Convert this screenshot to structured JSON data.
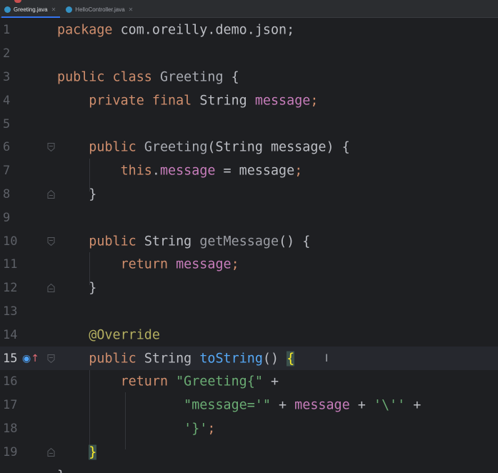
{
  "tabs": [
    {
      "label": "Greeting.java",
      "active": true
    },
    {
      "label": "HelloController.java",
      "active": false
    }
  ],
  "editor": {
    "current_line": 15,
    "lines": [
      {
        "num": "1",
        "tokens": [
          [
            "kw",
            "package"
          ],
          [
            "cls",
            " com.oreilly.demo.json;"
          ]
        ]
      },
      {
        "num": "2",
        "tokens": []
      },
      {
        "num": "3",
        "tokens": [
          [
            "kw",
            "public class "
          ],
          [
            "gray",
            "Greeting"
          ],
          [
            "cls",
            " {"
          ]
        ]
      },
      {
        "num": "4",
        "tokens": [
          [
            "cls",
            "    "
          ],
          [
            "kw",
            "private final "
          ],
          [
            "cls",
            "String "
          ],
          [
            "fld",
            "message"
          ],
          [
            "kw",
            ";"
          ]
        ]
      },
      {
        "num": "5",
        "tokens": []
      },
      {
        "num": "6",
        "tokens": [
          [
            "cls",
            "    "
          ],
          [
            "kw",
            "public "
          ],
          [
            "gray",
            "Greeting"
          ],
          [
            "cls",
            "(String message) {"
          ]
        ]
      },
      {
        "num": "7",
        "tokens": [
          [
            "cls",
            "        "
          ],
          [
            "kw",
            "this"
          ],
          [
            "cls",
            "."
          ],
          [
            "fld",
            "message"
          ],
          [
            "cls",
            " = message"
          ],
          [
            "kw",
            ";"
          ]
        ]
      },
      {
        "num": "8",
        "tokens": [
          [
            "cls",
            "    }"
          ]
        ]
      },
      {
        "num": "9",
        "tokens": []
      },
      {
        "num": "10",
        "tokens": [
          [
            "cls",
            "    "
          ],
          [
            "kw",
            "public "
          ],
          [
            "cls",
            "String "
          ],
          [
            "meth",
            "getMessage"
          ],
          [
            "cls",
            "() {"
          ]
        ]
      },
      {
        "num": "11",
        "tokens": [
          [
            "cls",
            "        "
          ],
          [
            "kw",
            "return "
          ],
          [
            "fld",
            "message"
          ],
          [
            "kw",
            ";"
          ]
        ]
      },
      {
        "num": "12",
        "tokens": [
          [
            "cls",
            "    }"
          ]
        ]
      },
      {
        "num": "13",
        "tokens": []
      },
      {
        "num": "14",
        "tokens": [
          [
            "cls",
            "    "
          ],
          [
            "ann",
            "@Override"
          ]
        ]
      },
      {
        "num": "15",
        "tokens": [
          [
            "cls",
            "    "
          ],
          [
            "kw",
            "public "
          ],
          [
            "cls",
            "String "
          ],
          [
            "fn",
            "toString"
          ],
          [
            "cls",
            "() "
          ],
          [
            "brace-hl",
            "{"
          ]
        ]
      },
      {
        "num": "16",
        "tokens": [
          [
            "cls",
            "        "
          ],
          [
            "kw",
            "return "
          ],
          [
            "str",
            "\"Greeting{\""
          ],
          [
            "cls",
            " +"
          ]
        ]
      },
      {
        "num": "17",
        "tokens": [
          [
            "cls",
            "                "
          ],
          [
            "str",
            "\"message='\""
          ],
          [
            "cls",
            " + "
          ],
          [
            "fld",
            "message"
          ],
          [
            "cls",
            " + "
          ],
          [
            "str",
            "'\\''"
          ],
          [
            "cls",
            " +"
          ]
        ]
      },
      {
        "num": "18",
        "tokens": [
          [
            "cls",
            "                "
          ],
          [
            "str",
            "'}'"
          ],
          [
            "kw",
            ";"
          ]
        ]
      },
      {
        "num": "19",
        "tokens": [
          [
            "cls",
            "    "
          ],
          [
            "brace-hl",
            "}"
          ]
        ]
      },
      {
        "num": "",
        "tokens": [
          [
            "cls",
            "}"
          ]
        ]
      }
    ]
  },
  "icons": {
    "override_marker": "override-up-arrow-icon",
    "fold": "fold-marker-icon"
  },
  "colors": {
    "background": "#1e1f22",
    "keyword": "#cf8e6d",
    "field": "#c77dbb",
    "string": "#6aab73",
    "annotation": "#b3ae60",
    "method_decl": "#56a8f5",
    "accent": "#3574f0"
  }
}
